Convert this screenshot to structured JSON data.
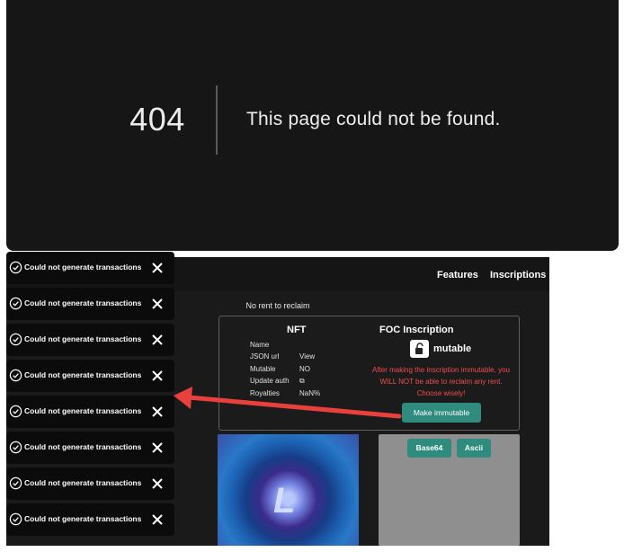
{
  "error_page": {
    "code": "404",
    "message": "This page could not be found."
  },
  "app": {
    "nav": {
      "features": "Features",
      "inscriptions": "Inscriptions"
    },
    "rent_status": "No rent to reclaim",
    "nft": {
      "title": "NFT",
      "rows": [
        {
          "label": "Name",
          "value": ""
        },
        {
          "label": "JSON url",
          "value": "View"
        },
        {
          "label": "Mutable",
          "value": "NO"
        },
        {
          "label": "Update auth",
          "value": "⧉"
        },
        {
          "label": "Royalties",
          "value": "NaN%"
        }
      ]
    },
    "foc": {
      "title": "FOC Inscription",
      "lock_icon": "unlocked-padlock-icon",
      "status": "mutable",
      "warning": "After making the inscription immutable, you WILL NOT be able to reclaim any rent. Choose wisely!",
      "button": "Make immutable"
    },
    "image_letter": "L",
    "tabs": {
      "base64": "Base64",
      "ascii": "Ascii"
    }
  },
  "toasts": [
    {
      "text": "Could not generate transactions"
    },
    {
      "text": "Could not generate transactions"
    },
    {
      "text": "Could not generate transactions"
    },
    {
      "text": "Could not generate transactions"
    },
    {
      "text": "Could not generate transactions"
    },
    {
      "text": "Could not generate transactions"
    },
    {
      "text": "Could not generate transactions"
    },
    {
      "text": "Could not generate transactions"
    }
  ],
  "colors": {
    "accent": "#2e8b7e",
    "warning": "#ef4d4d",
    "annotation": "#e8413c"
  }
}
